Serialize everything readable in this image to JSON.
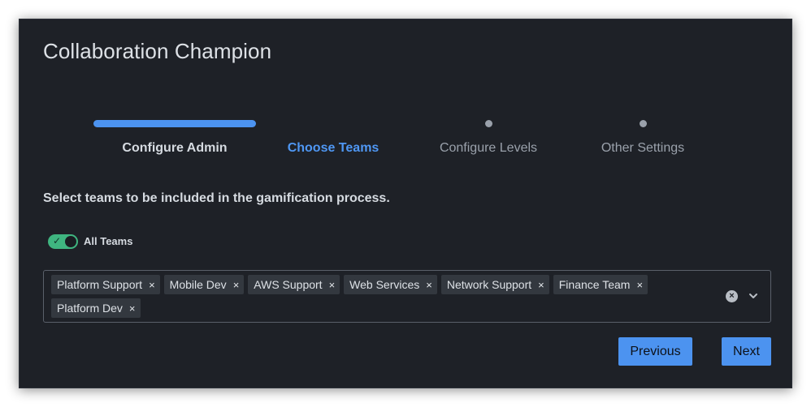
{
  "dialog": {
    "title": "Collaboration Champion"
  },
  "stepper": {
    "steps": [
      {
        "label": "Configure Admin",
        "state": "done"
      },
      {
        "label": "Choose Teams",
        "state": "active"
      },
      {
        "label": "Configure Levels",
        "state": "pending"
      },
      {
        "label": "Other Settings",
        "state": "pending"
      }
    ]
  },
  "instruction": "Select teams to be included in the gamification process.",
  "all_teams_toggle": {
    "label": "All Teams",
    "checked": true,
    "icon": "check-icon"
  },
  "teams_select": {
    "selected": [
      "Platform Support",
      "Mobile Dev",
      "AWS Support",
      "Web Services",
      "Network Support",
      "Finance Team",
      "Platform Dev"
    ],
    "remove_glyph": "×",
    "clear_icon": "clear-circle-icon",
    "dropdown_icon": "chevron-down-icon"
  },
  "buttons": {
    "previous": "Previous",
    "next": "Next"
  },
  "colors": {
    "background": "#1e2127",
    "accent": "#4c93f0",
    "toggle_on": "#3fb580",
    "chip": "#33383f"
  }
}
